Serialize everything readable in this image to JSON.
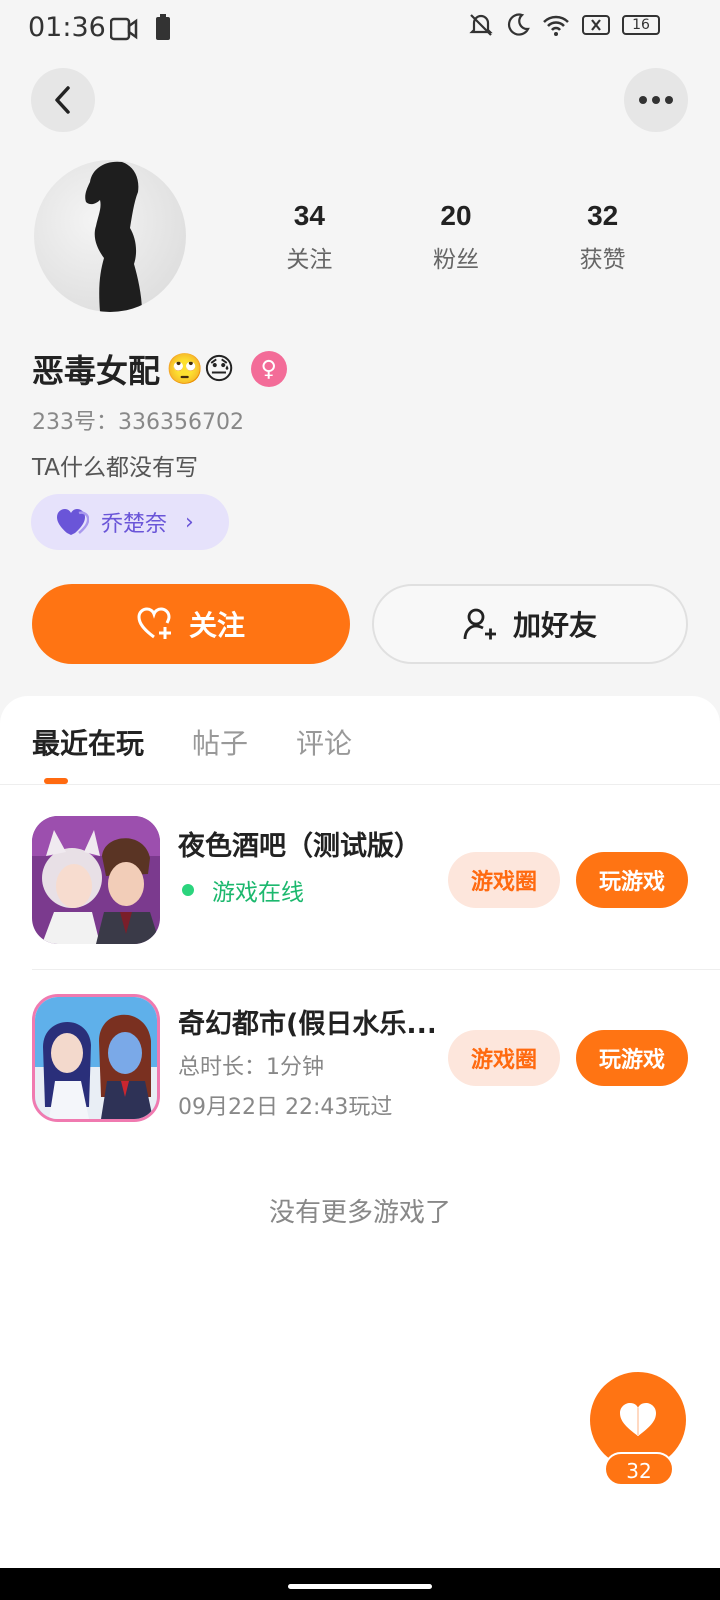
{
  "status_bar": {
    "time": "01:36",
    "battery_level": "16"
  },
  "profile": {
    "stats": [
      {
        "value": "34",
        "label": "关注"
      },
      {
        "value": "20",
        "label": "粉丝"
      },
      {
        "value": "32",
        "label": "获赞"
      }
    ],
    "nickname": "恶毒女配",
    "nickname_emojis": "🙄😓",
    "gender_symbol": "♀",
    "uid": "233号：336356702",
    "bio": "TA什么都没有写",
    "tag_label": "乔楚奈",
    "follow_label": "关注",
    "add_friend_label": "加好友"
  },
  "tabs": [
    {
      "label": "最近在玩",
      "active": true
    },
    {
      "label": "帖子",
      "active": false
    },
    {
      "label": "评论",
      "active": false
    }
  ],
  "games": [
    {
      "name": "夜色酒吧（测试版）",
      "status": "游戏在线",
      "circle_label": "游戏圈",
      "play_label": "玩游戏"
    },
    {
      "name": "奇幻都市(假日水乐...",
      "duration": "总时长：1分钟",
      "last_played": "09月22日 22:43玩过",
      "circle_label": "游戏圈",
      "play_label": "玩游戏"
    }
  ],
  "no_more_text": "没有更多游戏了",
  "like": {
    "count": "32"
  },
  "colors": {
    "accent": "#ff7413",
    "online": "#1cb86e",
    "tag": "#6a55d8"
  }
}
